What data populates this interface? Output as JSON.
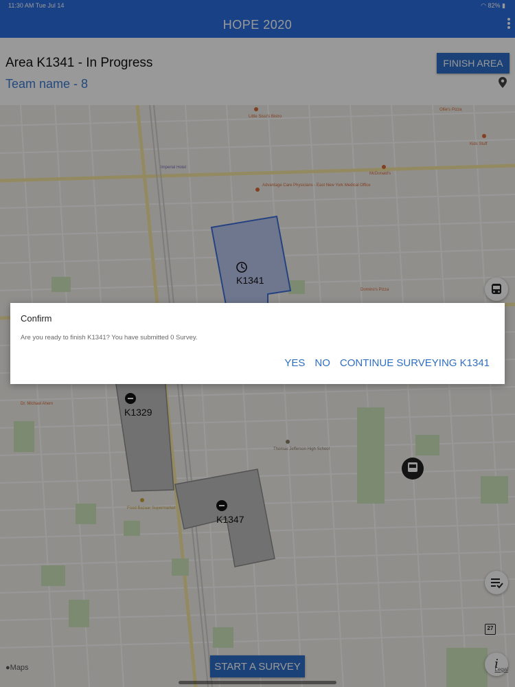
{
  "status_bar": {
    "time": "11:30 AM  Tue Jul 14",
    "battery": "82%"
  },
  "app": {
    "title": "HOPE 2020"
  },
  "header": {
    "area_title": "Area K1341 - In Progress",
    "team_name": "Team name - 8",
    "finish_label": "FINISH AREA"
  },
  "map": {
    "areas": [
      {
        "id": "K1341",
        "status_icon": "clock-icon",
        "color": "#3f6fd6"
      },
      {
        "id": "K1329",
        "status_icon": "minus-circle-icon",
        "color": "#9a9a9a"
      },
      {
        "id": "K1347",
        "status_icon": "minus-circle-icon",
        "color": "#9a9a9a"
      }
    ],
    "pois": [
      "Little Sissi's Bistro",
      "Imperial Hotel",
      "Advantage Care Physicians - East New York Medical Office",
      "McDonald's",
      "Domino's Pizza",
      "Ollie's Pizza",
      "Kids Stuff",
      "Dr. Michael Ahern",
      "Thomas Jefferson High School",
      "Food Bazaar Supermarket"
    ],
    "calendar_day": "27",
    "attribution": "Maps",
    "legal": "Legal"
  },
  "start_survey_label": "START A SURVEY",
  "dialog": {
    "title": "Confirm",
    "message": "Are you ready to finish K1341? You have submitted 0 Survey.",
    "yes": "YES",
    "no": "NO",
    "continue": "CONTINUE SURVEYING K1341"
  }
}
